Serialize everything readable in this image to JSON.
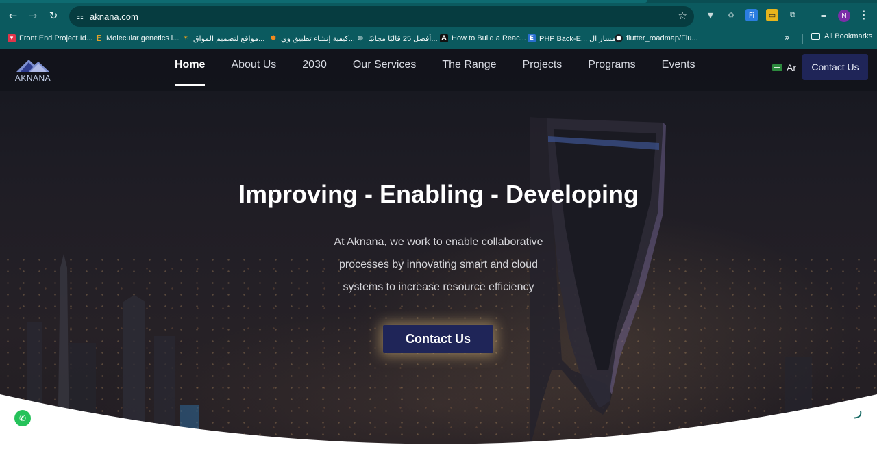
{
  "browser": {
    "url": "aknana.com",
    "icons": {
      "back": "arrow-left-icon",
      "forward": "arrow-right-icon",
      "reload": "reload-icon",
      "site_info": "tune-icon",
      "bookmark_star": "star-icon",
      "menu": "more-vert-icon"
    },
    "profile_initial": "N",
    "bookmarks": [
      {
        "label": "Front End Project Id...",
        "icon": "shield-icon",
        "color": "#e0344a"
      },
      {
        "label": "Molecular genetics i...",
        "icon": "E",
        "color": "#c8901e"
      },
      {
        "label": "مواقع لتصميم المواق...",
        "icon": "pinwheel-icon",
        "color": "#e9a11c"
      },
      {
        "label": "كيفية إنشاء تطبيق وي...",
        "icon": "cube-icon",
        "color": "#f08a1e"
      },
      {
        "label": "أفضل 25 قالبًا مجانيًا...",
        "icon": "globe-icon",
        "color": "#eef6f6"
      },
      {
        "label": "How to Build a Reac...",
        "icon": "A",
        "color": "#111111"
      },
      {
        "label": "PHP Back-E... مسار ال",
        "icon": "E",
        "color": "#2a6fd0"
      },
      {
        "label": "flutter_roadmap/Flu...",
        "icon": "github-icon",
        "color": "#1b1f23"
      }
    ],
    "all_bookmarks": "All Bookmarks"
  },
  "site": {
    "logo_text": "AKNANA",
    "nav": [
      {
        "label": "Home",
        "active": true
      },
      {
        "label": "About Us",
        "active": false
      },
      {
        "label": "2030",
        "active": false
      },
      {
        "label": "Our Services",
        "active": false
      },
      {
        "label": "The Range",
        "active": false
      },
      {
        "label": "Projects",
        "active": false
      },
      {
        "label": "Programs",
        "active": false
      },
      {
        "label": "Events",
        "active": false
      }
    ],
    "language": "Ar",
    "header_cta": "Contact Us"
  },
  "hero": {
    "title": "Improving - Enabling - Developing",
    "text_lines": [
      "At Aknana, we work to enable collaborative",
      "processes by innovating smart and cloud",
      "systems to increase resource efficiency"
    ],
    "cta": "Contact Us"
  },
  "colors": {
    "chrome": "#0b5a5f",
    "header_bg": "#12131b",
    "primary": "#1f2558",
    "cta_glow": "#ffd68c"
  }
}
